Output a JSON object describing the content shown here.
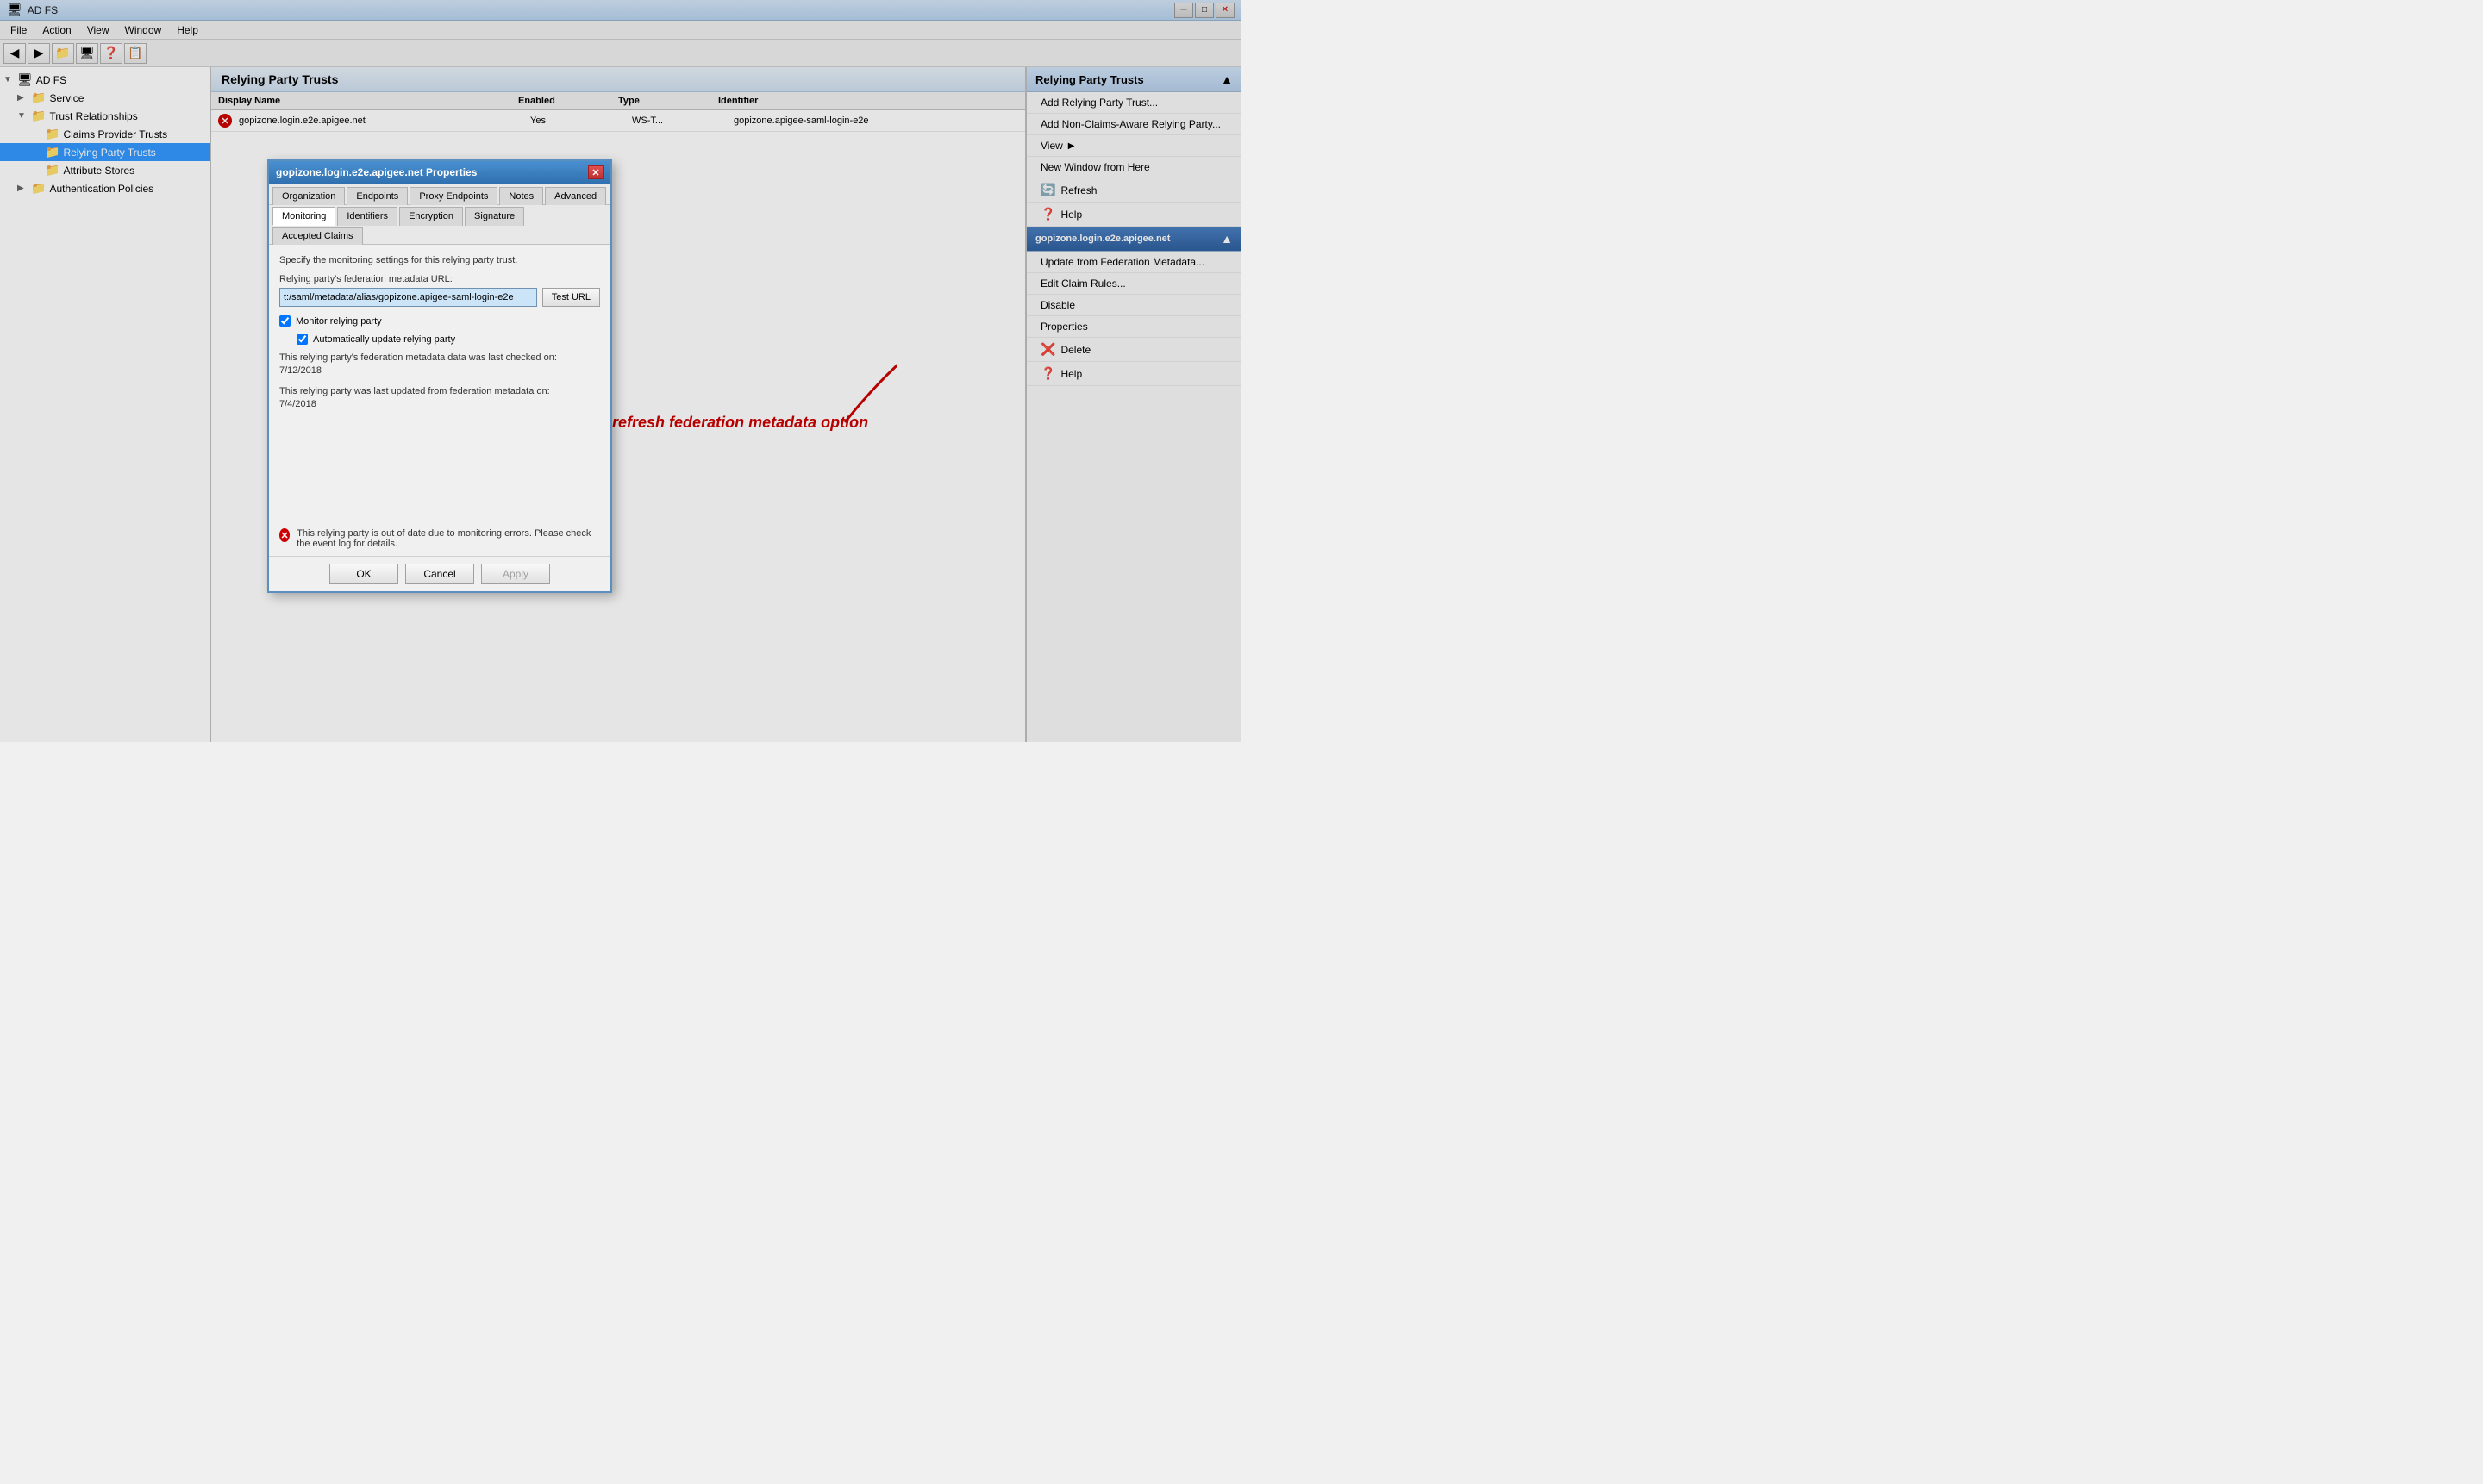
{
  "window": {
    "title": "AD FS",
    "icon": "🖥"
  },
  "menubar": {
    "items": [
      "File",
      "Action",
      "View",
      "Window",
      "Help"
    ]
  },
  "toolbar": {
    "buttons": [
      "◀",
      "▶",
      "📁",
      "🖥",
      "❓",
      "📋"
    ]
  },
  "tree": {
    "items": [
      {
        "label": "AD FS",
        "level": 0,
        "expanded": true,
        "icon": "🖥"
      },
      {
        "label": "Service",
        "level": 1,
        "expanded": false,
        "icon": "📁"
      },
      {
        "label": "Trust Relationships",
        "level": 1,
        "expanded": true,
        "icon": "📁"
      },
      {
        "label": "Claims Provider Trusts",
        "level": 2,
        "expanded": false,
        "icon": "📁"
      },
      {
        "label": "Relying Party Trusts",
        "level": 2,
        "expanded": false,
        "icon": "📁"
      },
      {
        "label": "Attribute Stores",
        "level": 2,
        "expanded": false,
        "icon": "📁"
      },
      {
        "label": "Authentication Policies",
        "level": 1,
        "expanded": false,
        "icon": "📁"
      }
    ]
  },
  "center_panel": {
    "title": "Relying Party Trusts",
    "columns": [
      "Display Name",
      "Enabled",
      "Type",
      "Identifier"
    ],
    "rows": [
      {
        "icon": "❌",
        "name": "gopizone.login.e2e.apigee.net",
        "enabled": "Yes",
        "type": "WS-T...",
        "identifier": "gopizone.apigee-saml-login-e2e"
      }
    ]
  },
  "actions_panel": {
    "sections": [
      {
        "title": "Relying Party Trusts",
        "items": [
          {
            "label": "Add Relying Party Trust...",
            "icon": ""
          },
          {
            "label": "Add Non-Claims-Aware Relying Party...",
            "icon": ""
          },
          {
            "label": "View",
            "icon": "",
            "hasArrow": true
          },
          {
            "label": "New Window from Here",
            "icon": ""
          },
          {
            "label": "Refresh",
            "icon": "🔄"
          },
          {
            "label": "Help",
            "icon": "❓"
          }
        ]
      },
      {
        "title": "gopizone.login.e2e.apigee.net",
        "selected": true,
        "items": [
          {
            "label": "Update from Federation Metadata...",
            "icon": ""
          },
          {
            "label": "Edit Claim Rules...",
            "icon": ""
          },
          {
            "label": "Disable",
            "icon": ""
          },
          {
            "label": "Properties",
            "icon": ""
          },
          {
            "label": "Delete",
            "icon": "❌"
          },
          {
            "label": "Help",
            "icon": "❓"
          }
        ]
      }
    ]
  },
  "dialog": {
    "title": "gopizone.login.e2e.apigee.net Properties",
    "tabs_row1": [
      "Organization",
      "Endpoints",
      "Proxy Endpoints",
      "Notes",
      "Advanced"
    ],
    "tabs_row2": [
      "Monitoring",
      "Identifiers",
      "Encryption",
      "Signature",
      "Accepted Claims"
    ],
    "active_tab": "Monitoring",
    "description": "Specify the monitoring settings for this relying party trust.",
    "metadata_url_label": "Relying party's federation metadata URL:",
    "metadata_url_value": "t:/saml/metadata/alias/gopizone.apigee-saml-login-e2e",
    "test_url_button": "Test URL",
    "monitor_checkbox_label": "Monitor relying party",
    "monitor_checked": true,
    "auto_update_checkbox_label": "Automatically update relying party",
    "auto_update_checked": true,
    "last_checked_text": "This relying party's federation metadata data was last checked on:",
    "last_checked_date": "7/12/2018",
    "last_updated_text": "This relying party was last updated from federation metadata on:",
    "last_updated_date": "7/4/2018",
    "error_message": "This relying party is out of date due to monitoring errors.  Please check the event log for details.",
    "buttons": {
      "ok": "OK",
      "cancel": "Cancel",
      "apply": "Apply"
    }
  },
  "annotation": {
    "text": "Click the refresh federation metadata option"
  }
}
